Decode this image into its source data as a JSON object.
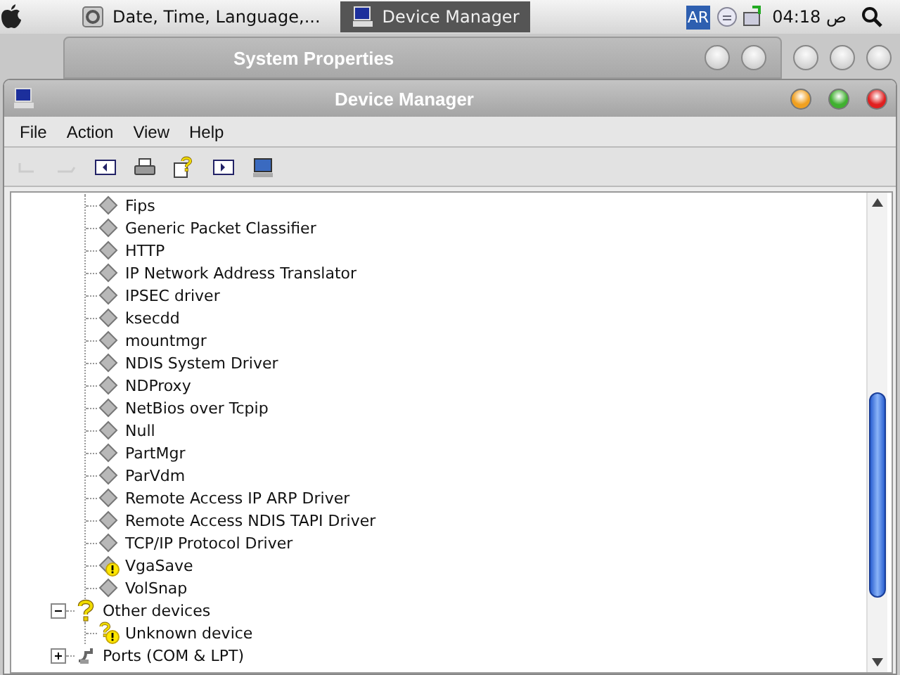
{
  "top_bar": {
    "tasks": [
      {
        "label": "Date, Time, Language,...",
        "selected": false,
        "kind": "control-panel"
      },
      {
        "label": "Device Manager",
        "selected": true,
        "kind": "computer"
      }
    ],
    "language": "AR",
    "clock": "04:18 ص"
  },
  "back_window": {
    "title": "System Properties"
  },
  "window": {
    "title": "Device Manager"
  },
  "menu": [
    "File",
    "Action",
    "View",
    "Help"
  ],
  "tree": [
    {
      "children": [
        {
          "label": "Fips",
          "kind": "driver",
          "warning": false
        },
        {
          "label": "Generic Packet Classifier",
          "kind": "driver",
          "warning": false
        },
        {
          "label": "HTTP",
          "kind": "driver",
          "warning": false
        },
        {
          "label": "IP Network Address Translator",
          "kind": "driver",
          "warning": false
        },
        {
          "label": "IPSEC driver",
          "kind": "driver",
          "warning": false
        },
        {
          "label": "ksecdd",
          "kind": "driver",
          "warning": false
        },
        {
          "label": "mountmgr",
          "kind": "driver",
          "warning": false
        },
        {
          "label": "NDIS System Driver",
          "kind": "driver",
          "warning": false
        },
        {
          "label": "NDProxy",
          "kind": "driver",
          "warning": false
        },
        {
          "label": "NetBios over Tcpip",
          "kind": "driver",
          "warning": false
        },
        {
          "label": "Null",
          "kind": "driver",
          "warning": false
        },
        {
          "label": "PartMgr",
          "kind": "driver",
          "warning": false
        },
        {
          "label": "ParVdm",
          "kind": "driver",
          "warning": false
        },
        {
          "label": "Remote Access IP ARP Driver",
          "kind": "driver",
          "warning": false
        },
        {
          "label": "Remote Access NDIS TAPI Driver",
          "kind": "driver",
          "warning": false
        },
        {
          "label": "TCP/IP Protocol Driver",
          "kind": "driver",
          "warning": false
        },
        {
          "label": "VgaSave",
          "kind": "driver",
          "warning": true
        },
        {
          "label": "VolSnap",
          "kind": "driver",
          "warning": false
        }
      ]
    },
    {
      "label": "Other devices",
      "kind": "unknown",
      "warning": false,
      "expanded": true,
      "children": [
        {
          "label": "Unknown device",
          "kind": "unknown",
          "warning": true
        }
      ]
    },
    {
      "label": "Ports (COM & LPT)",
      "kind": "port",
      "warning": false,
      "expanded": false
    }
  ]
}
